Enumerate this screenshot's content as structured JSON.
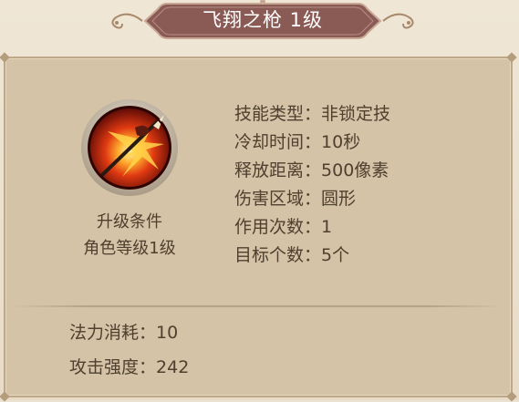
{
  "title": "飞翔之枪 1级",
  "skill_icon": "spear-slash-icon",
  "upgrade": {
    "label": "升级条件",
    "requirement": "角色等级1级"
  },
  "stats": [
    {
      "label": "技能类型",
      "sep": "：",
      "value": "非锁定技"
    },
    {
      "label": "冷却时间",
      "sep": "：",
      "value": "10秒"
    },
    {
      "label": "释放距离",
      "sep": "：",
      "value": "500像素"
    },
    {
      "label": "伤害区域",
      "sep": "：",
      "value": "圆形"
    },
    {
      "label": "作用次数",
      "sep": "：",
      "value": "1"
    },
    {
      "label": "目标个数",
      "sep": "：",
      "value": "5个"
    }
  ],
  "cost": {
    "label": "法力消耗",
    "sep": "：",
    "value": "10"
  },
  "attack": {
    "label": "攻击强度",
    "sep": "：",
    "value": "242"
  },
  "colors": {
    "panel": "#d4c3a6",
    "banner": "#8a5a55",
    "text": "#4f4030"
  }
}
